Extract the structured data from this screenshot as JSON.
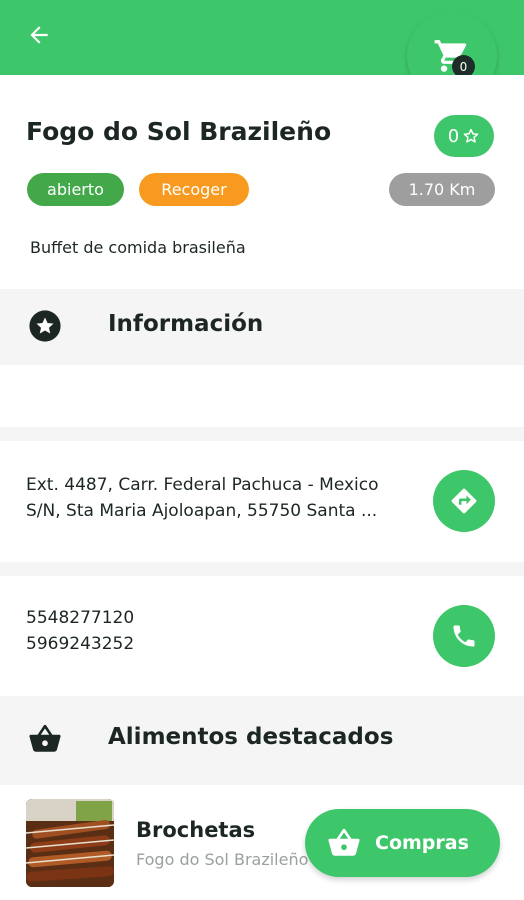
{
  "cart": {
    "count": "0"
  },
  "restaurant": {
    "name": "Fogo do Sol Brazileño",
    "rating": "0",
    "status": "abierto",
    "mode": "Recoger",
    "distance": "1.70 Km",
    "description": "Buffet de comida brasileña"
  },
  "sections": {
    "info_title": "Información",
    "featured_title": "Alimentos destacados"
  },
  "contact": {
    "address_line1": "Ext. 4487, Carr. Federal Pachuca - Mexico",
    "address_line2": "S/N, Sta Maria Ajoloapan, 55750 Santa ...",
    "phone1": "5548277120",
    "phone2": "5969243252"
  },
  "featured": [
    {
      "name": "Brochetas",
      "restaurant": "Fogo do Sol Brazileño"
    }
  ],
  "compras_label": "Compras",
  "colors": {
    "primary": "#3ec76a",
    "open": "#43a84a",
    "pickup": "#f79a1f",
    "distance": "#9e9e9e",
    "dark": "#1c2724"
  },
  "icons": [
    "back-arrow-icon",
    "cart-icon",
    "star-icon",
    "directions-icon",
    "phone-icon",
    "basket-icon"
  ]
}
